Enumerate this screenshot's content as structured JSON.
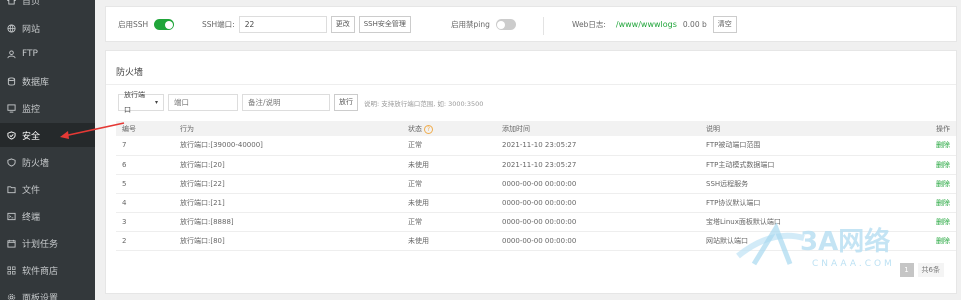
{
  "sidebar": {
    "items": [
      {
        "label": "首页",
        "icon": "home-icon"
      },
      {
        "label": "网站",
        "icon": "globe-icon"
      },
      {
        "label": "FTP",
        "icon": "user-icon"
      },
      {
        "label": "数据库",
        "icon": "database-icon"
      },
      {
        "label": "监控",
        "icon": "monitor-icon"
      },
      {
        "label": "安全",
        "icon": "shield-icon"
      },
      {
        "label": "防火墙",
        "icon": "firewall-icon"
      },
      {
        "label": "文件",
        "icon": "folder-icon"
      },
      {
        "label": "终端",
        "icon": "terminal-icon"
      },
      {
        "label": "计划任务",
        "icon": "calendar-icon"
      },
      {
        "label": "软件商店",
        "icon": "grid-icon"
      },
      {
        "label": "面板设置",
        "icon": "gear-icon"
      }
    ],
    "active_index": 5
  },
  "ssh": {
    "enable_label": "启用SSH",
    "enabled": true,
    "port_label": "SSH端口:",
    "port_value": "22",
    "change_button": "更改",
    "manage_button": "SSH安全管理",
    "ping_label": "启用禁ping",
    "ping_enabled": false,
    "weblog_label": "Web日志:",
    "weblog_path": "/www/wwwlogs",
    "weblog_size": "0.00 b",
    "clear_button": "清空"
  },
  "firewall": {
    "title": "防火墙",
    "select_value": "放行端口",
    "port_placeholder": "端口",
    "remark_placeholder": "备注/说明",
    "allow_button": "放行",
    "hint": "说明: 支持放行端口范围, 如: 3000:3500",
    "columns": [
      "编号",
      "行为",
      "状态",
      "添加时间",
      "说明",
      "操作"
    ],
    "rows": [
      {
        "id": "7",
        "action": "放行端口:[39000-40000]",
        "status": "正常",
        "time": "2021-11-10 23:05:27",
        "desc": "FTP被动端口范围",
        "op": "删除"
      },
      {
        "id": "6",
        "action": "放行端口:[20]",
        "status": "未使用",
        "time": "2021-11-10 23:05:27",
        "desc": "FTP主动模式数据端口",
        "op": "删除"
      },
      {
        "id": "5",
        "action": "放行端口:[22]",
        "status": "正常",
        "time": "0000-00-00 00:00:00",
        "desc": "SSH远程服务",
        "op": "删除"
      },
      {
        "id": "4",
        "action": "放行端口:[21]",
        "status": "未使用",
        "time": "0000-00-00 00:00:00",
        "desc": "FTP协议默认端口",
        "op": "删除"
      },
      {
        "id": "3",
        "action": "放行端口:[8888]",
        "status": "正常",
        "time": "0000-00-00 00:00:00",
        "desc": "宝塔Linux面板默认端口",
        "op": "删除"
      },
      {
        "id": "2",
        "action": "放行端口:[80]",
        "status": "未使用",
        "time": "0000-00-00 00:00:00",
        "desc": "网站默认端口",
        "op": "删除"
      }
    ],
    "pager": {
      "page": "1",
      "total": "共6条"
    }
  },
  "watermark": {
    "brand": "3A网络",
    "domain": "CNAAA.COM"
  },
  "colors": {
    "sidebar_bg": "#33383b",
    "accent": "#20a53a",
    "arrow": "#e53935"
  }
}
